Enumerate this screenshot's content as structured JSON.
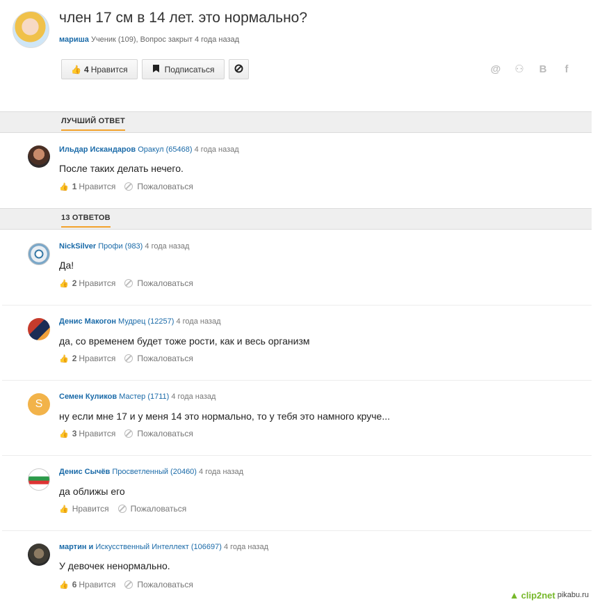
{
  "question": {
    "title": "член 17 см в 14 лет. это нормально?",
    "author": "мариша",
    "meta": "Ученик (109), Вопрос закрыт 4 года назад",
    "like_count": "4",
    "like_label": "Нравится",
    "subscribe_label": "Подписаться"
  },
  "share": {
    "mail": "@",
    "ok": "⚇",
    "vk": "B",
    "fb": "f"
  },
  "best_answer_tab": "ЛУЧШИЙ ОТВЕТ",
  "best_answer": {
    "author": "Ильдар Искандаров",
    "rank": "Оракул (65468)",
    "date": "4 года назад",
    "text": "После таких делать нечего.",
    "likes": "1",
    "like_label": "Нравится",
    "report_label": "Пожаловаться"
  },
  "answers_tab": "13 ОТВЕТОВ",
  "answers": [
    {
      "author": "NickSilver",
      "rank": "Профи (983)",
      "date": "4 года назад",
      "text": "Да!",
      "likes": "2",
      "like_label": "Нравится",
      "report_label": "Пожаловаться"
    },
    {
      "author": "Денис Макогон",
      "rank": "Мудрец (12257)",
      "date": "4 года назад",
      "text": "да, со временем будет тоже рости, как и весь организм",
      "likes": "2",
      "like_label": "Нравится",
      "report_label": "Пожаловаться"
    },
    {
      "author": "Семен Куликов",
      "rank": "Мастер (1711)",
      "date": "4 года назад",
      "text": "ну если мне 17 и у меня 14 это нормально, то у тебя это намного круче...",
      "likes": "3",
      "like_label": "Нравится",
      "report_label": "Пожаловаться",
      "avatar_letter": "S"
    },
    {
      "author": "Денис Сычёв",
      "rank": "Просветленный (20460)",
      "date": "4 года назад",
      "text": "да оближы его",
      "likes": "",
      "like_label": "Нравится",
      "report_label": "Пожаловаться"
    },
    {
      "author": "мартин и",
      "rank": "Искусственный Интеллект (106697)",
      "date": "4 года назад",
      "text": "У девочек ненормально.",
      "likes": "6",
      "like_label": "Нравится",
      "report_label": "Пожаловаться"
    }
  ],
  "watermark": {
    "brand": "clip2net",
    "site": "pikabu.ru"
  }
}
